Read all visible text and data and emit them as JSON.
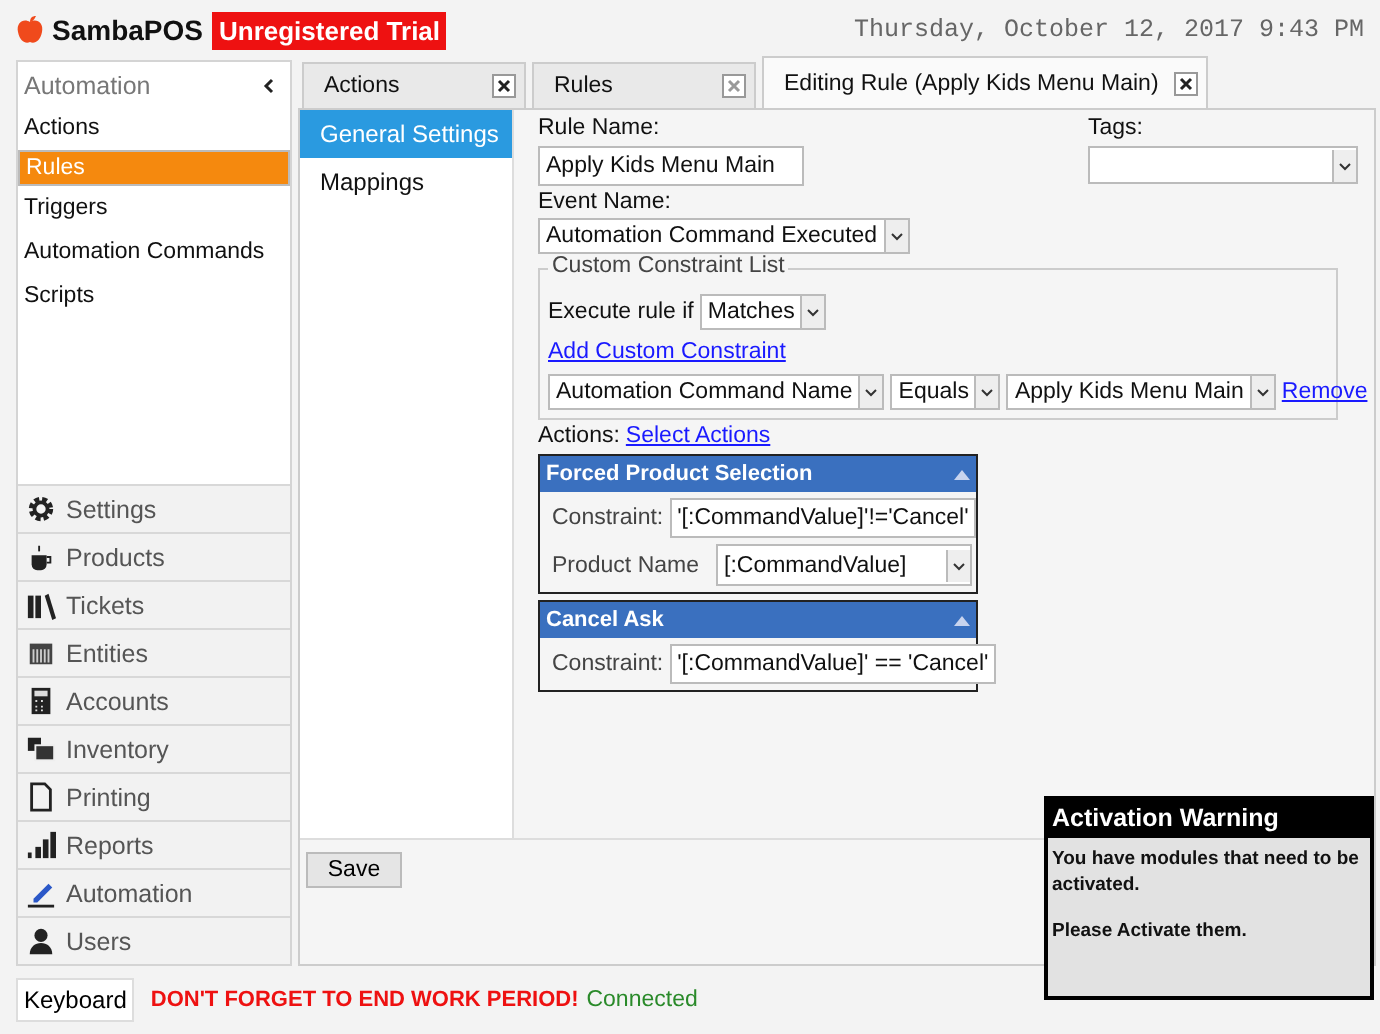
{
  "header": {
    "logo": "SambaPOS",
    "badge": "Unregistered Trial",
    "datetime": "Thursday, October 12, 2017 9:43 PM"
  },
  "sidebar": {
    "title": "Automation",
    "items": [
      {
        "label": "Actions",
        "selected": false
      },
      {
        "label": "Rules",
        "selected": true
      },
      {
        "label": "Triggers",
        "selected": false
      },
      {
        "label": "Automation Commands",
        "selected": false
      },
      {
        "label": "Scripts",
        "selected": false
      }
    ],
    "modules": [
      {
        "label": "Settings"
      },
      {
        "label": "Products"
      },
      {
        "label": "Tickets"
      },
      {
        "label": "Entities"
      },
      {
        "label": "Accounts"
      },
      {
        "label": "Inventory"
      },
      {
        "label": "Printing"
      },
      {
        "label": "Reports"
      },
      {
        "label": "Automation"
      },
      {
        "label": "Users"
      }
    ]
  },
  "tabs": [
    {
      "label": "Actions",
      "selected": false
    },
    {
      "label": "Rules",
      "selected": false
    },
    {
      "label": "Editing Rule (Apply Kids Menu Main)",
      "selected": true
    }
  ],
  "subnav": [
    {
      "label": "General Settings",
      "selected": true
    },
    {
      "label": "Mappings",
      "selected": false
    }
  ],
  "form": {
    "rule_name_label": "Rule Name:",
    "rule_name": "Apply Kids Menu Main",
    "tags_label": "Tags:",
    "event_label": "Event Name:",
    "event": "Automation Command Executed",
    "constraints": {
      "legend": "Custom Constraint List",
      "execute_label": "Execute rule if",
      "execute": "Matches",
      "add_link": "Add Custom Constraint",
      "row": {
        "field": "Automation Command Name",
        "operator": "Equals",
        "value": "Apply Kids Menu Main",
        "remove": "Remove"
      }
    },
    "actions_label": "Actions:",
    "select_link": "Select Actions",
    "actions": [
      {
        "title": "Forced Product Selection",
        "fields": [
          {
            "kind": "text",
            "label": "Constraint:",
            "value": "'[:CommandValue]'!='Cancel'"
          },
          {
            "kind": "select",
            "label": "Product Name",
            "value": "[:CommandValue]"
          }
        ]
      },
      {
        "title": "Cancel Ask",
        "fields": [
          {
            "kind": "text",
            "label": "Constraint:",
            "value": "'[:CommandValue]' == 'Cancel'"
          }
        ]
      }
    ]
  },
  "save_button": "Save",
  "status_bar": {
    "keyboard": "Keyboard",
    "warning": "DON'T FORGET TO END WORK PERIOD!",
    "connection": "Connected"
  },
  "popup": {
    "title": "Activation Warning",
    "lines": [
      "You have modules that need to be activated.",
      "Please Activate them."
    ]
  }
}
